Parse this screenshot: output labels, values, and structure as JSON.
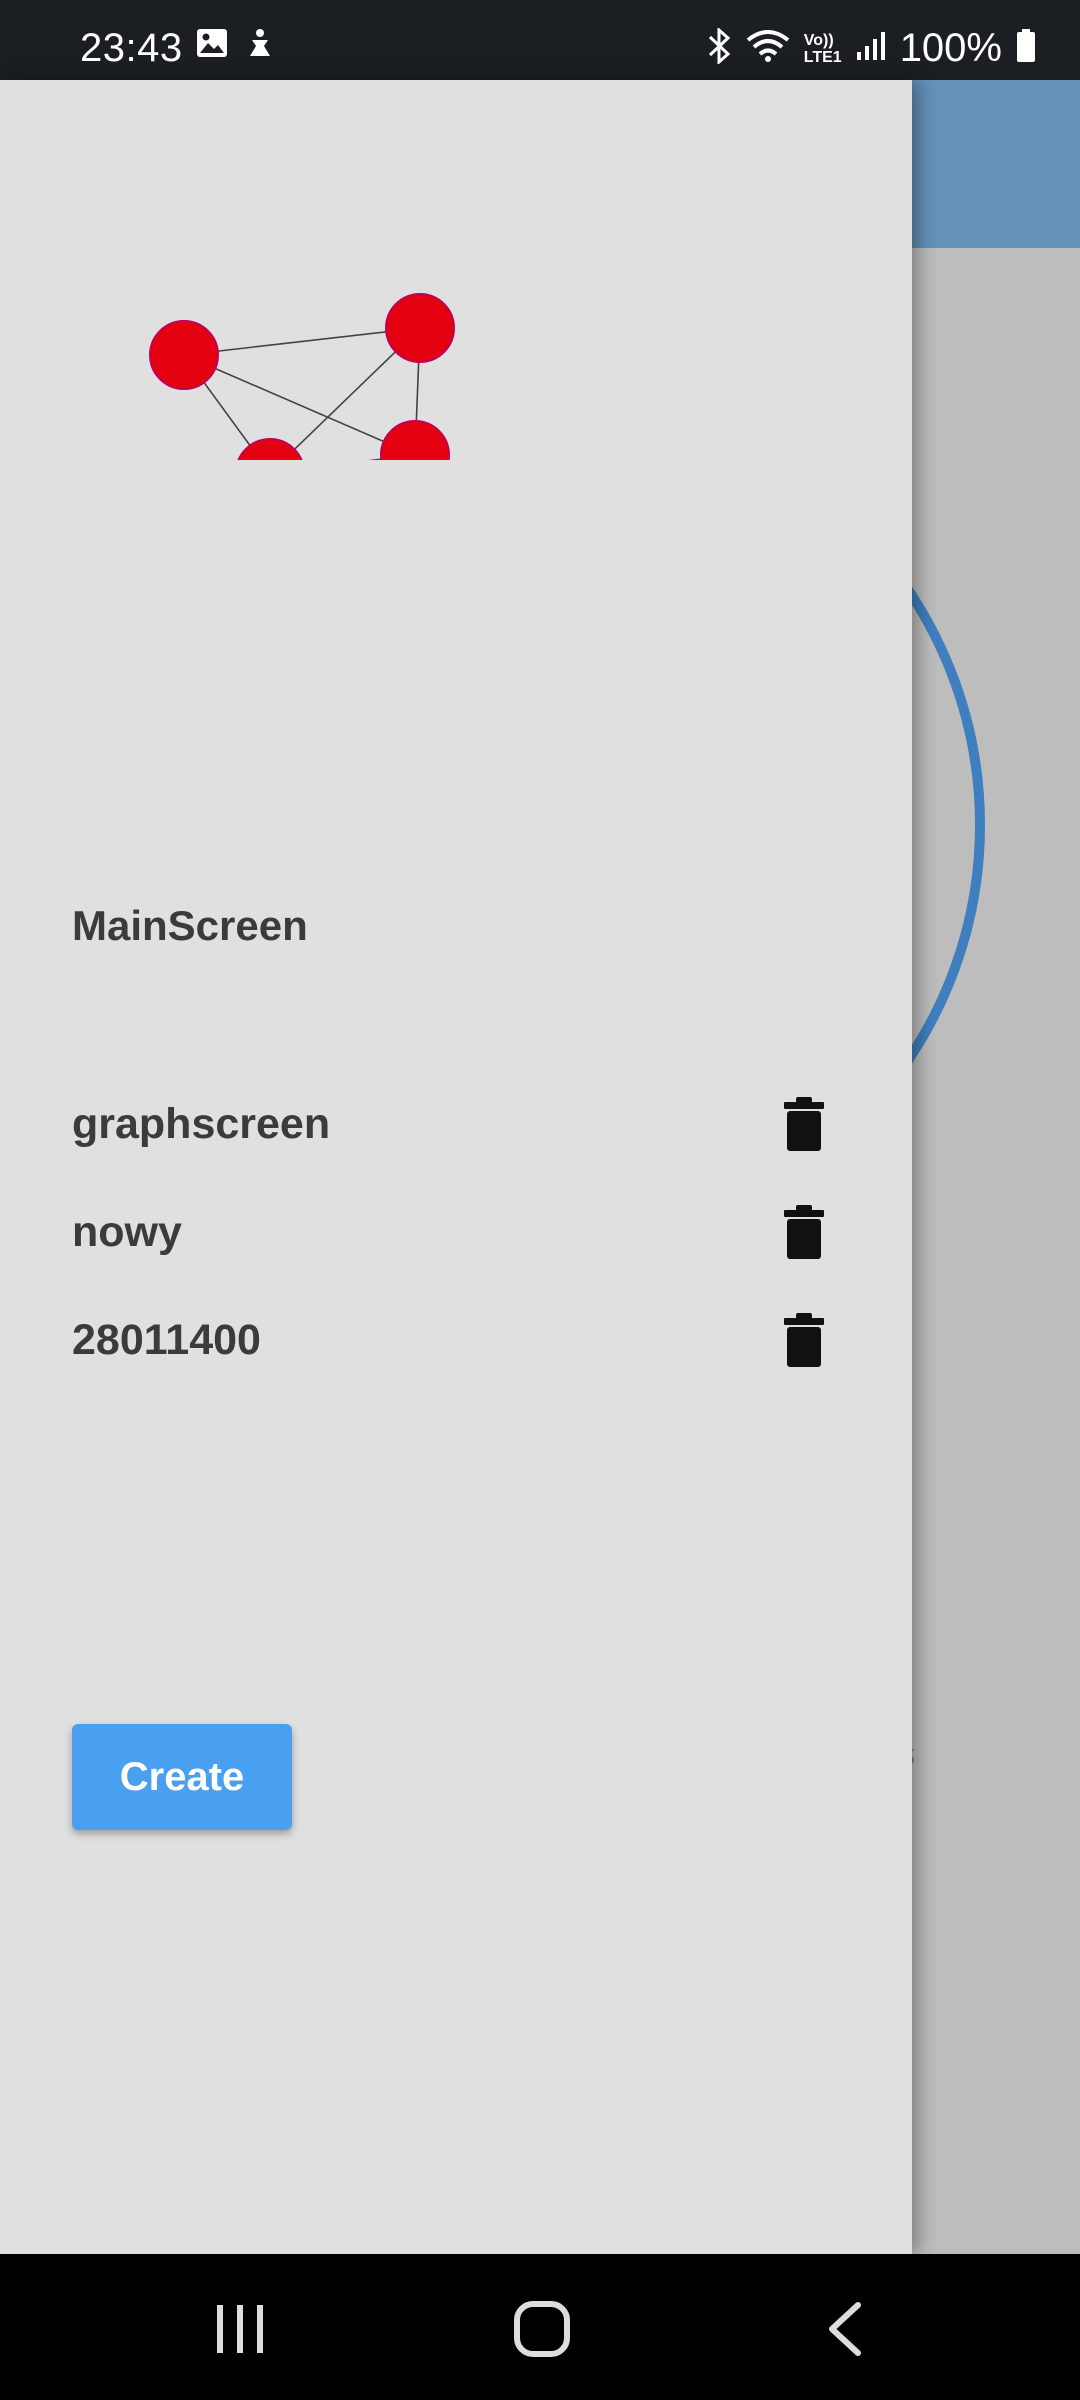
{
  "status_bar": {
    "time": "23:43",
    "battery": "100%",
    "icons_left": [
      "gallery-icon",
      "accessibility-icon"
    ],
    "icons_right": [
      "bluetooth-icon",
      "wifi-icon",
      "volte-icon",
      "signal-icon",
      "battery-icon"
    ],
    "volte_label_top": "Vo))",
    "volte_label_bottom": "LTE1"
  },
  "drawer": {
    "logo": "graph-logo",
    "main_screen_label": "MainScreen",
    "screens": [
      {
        "name": "graphscreen",
        "action_icon": "trash-icon"
      },
      {
        "name": "nowy",
        "action_icon": "trash-icon"
      },
      {
        "name": "28011400",
        "action_icon": "trash-icon"
      }
    ],
    "create_label": "Create"
  },
  "background": {
    "appbar_color": "#6591ba",
    "arc_color": "#3f7fc0",
    "small_text": "s"
  },
  "nav_bar": {
    "buttons": [
      "recents-icon",
      "home-icon",
      "back-icon"
    ]
  },
  "colors": {
    "node_red": "#e3000f",
    "create_button": "#4aa0f0",
    "drawer_bg": "#e0e0e0"
  }
}
